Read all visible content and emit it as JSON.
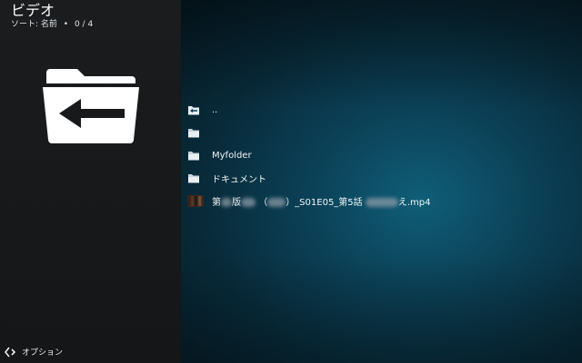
{
  "header": {
    "title": "ビデオ",
    "sort_label": "ソート: 名前",
    "separator": "•",
    "count": "0 / 4"
  },
  "panel_icon": "folder-back-icon",
  "file_list": {
    "items": [
      {
        "label": "..",
        "icon": "parent-folder-icon"
      },
      {
        "label": "",
        "icon": "folder-icon"
      },
      {
        "label": "Myfolder",
        "icon": "folder-icon"
      },
      {
        "label": "ドキュメント",
        "icon": "folder-icon"
      },
      {
        "label_parts": [
          "第",
          "版",
          "（",
          "）_S01E05_第5話",
          "え.mp4"
        ],
        "icon": "video-thumbnail"
      }
    ]
  },
  "footer": {
    "options_label": "オプション",
    "icon": "options-arrows-icon"
  },
  "colors": {
    "left_panel": "#17191b",
    "right_bg_center": "#0f5e78",
    "right_bg_edge": "#061a24",
    "text": "#f2f6f8"
  }
}
